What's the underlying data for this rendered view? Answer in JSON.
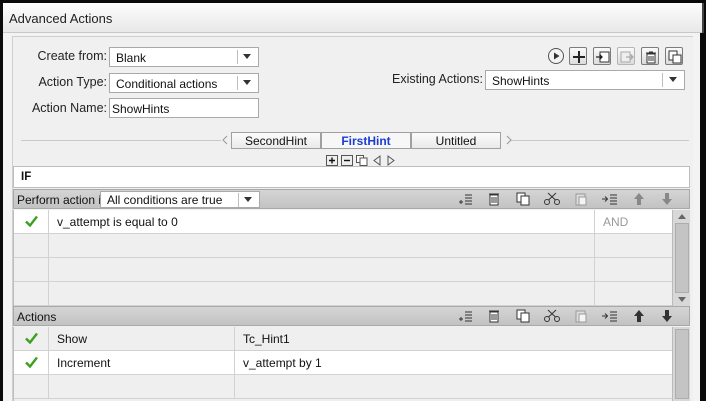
{
  "window": {
    "title": "Advanced Actions"
  },
  "form": {
    "create_from_label": "Create from:",
    "create_from_value": "Blank",
    "action_type_label": "Action Type:",
    "action_type_value": "Conditional actions",
    "action_name_label": "Action Name:",
    "action_name_value": "ShowHints",
    "existing_actions_label": "Existing Actions:",
    "existing_actions_value": "ShowHints"
  },
  "toolbar_icons": [
    "preview-icon",
    "add-icon",
    "import-icon",
    "export-icon",
    "trash-icon",
    "duplicate-icon"
  ],
  "tabs": [
    {
      "label": "SecondHint",
      "active": false
    },
    {
      "label": "FirstHint",
      "active": true
    },
    {
      "label": "Untitled",
      "active": false
    }
  ],
  "if_section": {
    "label": "IF",
    "perform_label": "Perform action if:",
    "condition_mode": "All conditions are true",
    "conditions": [
      {
        "checked": true,
        "expression": "v_attempt   is equal to    0",
        "operator": "AND"
      },
      {
        "checked": false,
        "expression": "",
        "operator": ""
      },
      {
        "checked": false,
        "expression": "",
        "operator": ""
      },
      {
        "checked": false,
        "expression": "",
        "operator": ""
      }
    ]
  },
  "actions_section": {
    "label": "Actions",
    "rows": [
      {
        "checked": true,
        "action": "Show",
        "target": "Tc_Hint1"
      },
      {
        "checked": true,
        "action": "Increment",
        "target": "v_attempt    by    1"
      },
      {
        "checked": false,
        "action": "",
        "target": ""
      }
    ]
  },
  "colors": {
    "check_green": "#3ca021",
    "active_tab": "#1a3cd6"
  }
}
